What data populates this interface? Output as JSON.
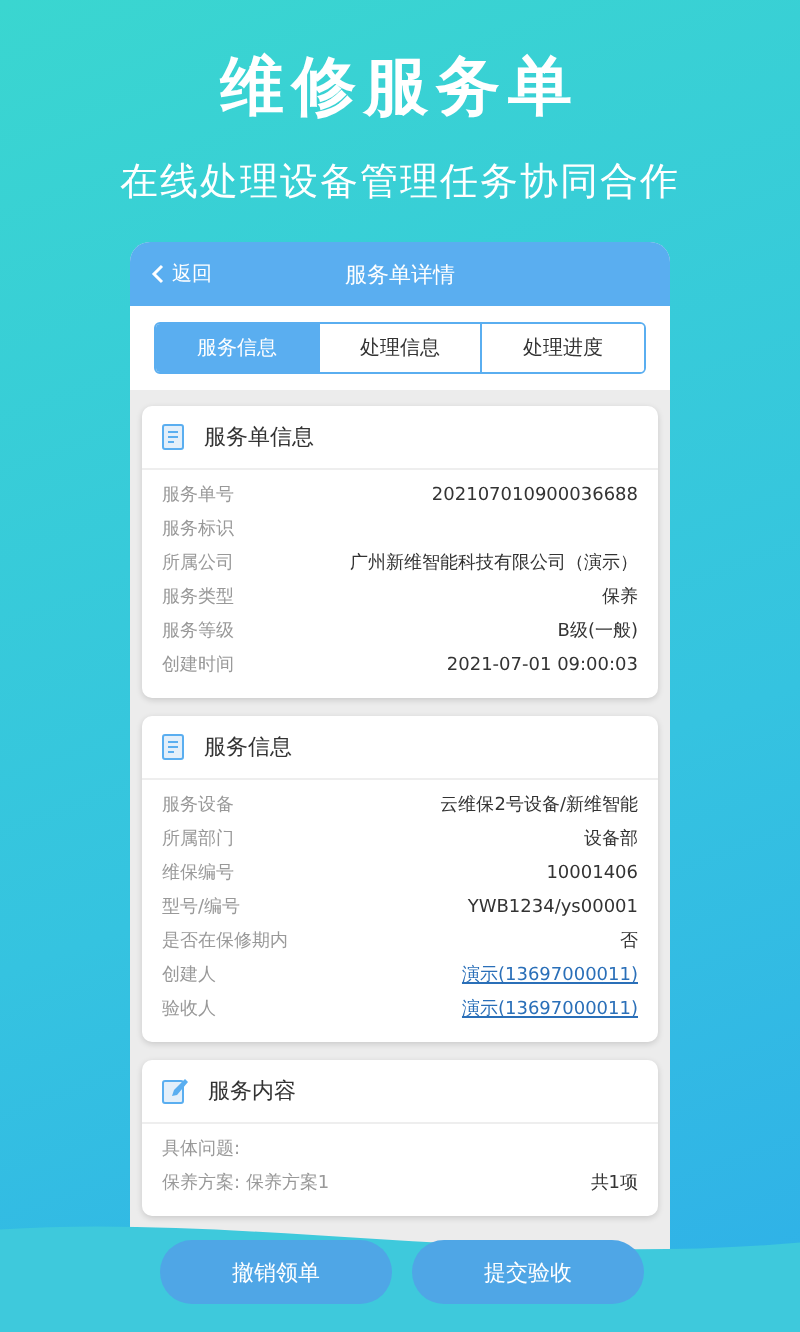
{
  "hero": {
    "title": "维修服务单",
    "subtitle": "在线处理设备管理任务协同合作"
  },
  "phone": {
    "back": "返回",
    "title": "服务单详情",
    "tabs": [
      {
        "label": "服务信息",
        "selected": true
      },
      {
        "label": "处理信息",
        "selected": false
      },
      {
        "label": "处理进度",
        "selected": false
      }
    ],
    "cards": [
      {
        "title": "服务单信息",
        "kind": "clipboard",
        "rows": [
          {
            "label": "服务单号",
            "value": "202107010900036688",
            "link": false
          },
          {
            "label": "服务标识"
          },
          {
            "label": "所属公司",
            "value": "广州新维智能科技有限公司（演示）",
            "link": false
          },
          {
            "label": "服务类型",
            "value": "保养",
            "link": false
          },
          {
            "label": "服务等级",
            "value": "B级(一般)",
            "link": false
          },
          {
            "label": "创建时间",
            "value": "2021-07-01 09:00:03",
            "link": false
          }
        ]
      },
      {
        "title": "服务信息",
        "kind": "clipboard",
        "rows": [
          {
            "label": "服务设备",
            "value": "云维保2号设备/新维智能",
            "link": false
          },
          {
            "label": "所属部门",
            "value": "设备部",
            "link": false
          },
          {
            "label": "维保编号",
            "value": "10001406",
            "link": false
          },
          {
            "label": "型号/编号",
            "value": "YWB1234/ys00001",
            "link": false
          },
          {
            "label": "是否在保修期内",
            "value": "否",
            "link": false
          },
          {
            "label": "创建人",
            "value": "演示(13697000011)",
            "link": true
          },
          {
            "label": "验收人",
            "value": "演示(13697000011)",
            "link": true
          }
        ]
      },
      {
        "title": "服务内容",
        "kind": "edit",
        "rows": [
          {
            "label": "具体问题:"
          },
          {
            "label": "保养方案:  保养方案1",
            "value": "共1项",
            "link": false
          }
        ]
      }
    ],
    "buttons": [
      "撤销领单",
      "提交验收"
    ]
  }
}
